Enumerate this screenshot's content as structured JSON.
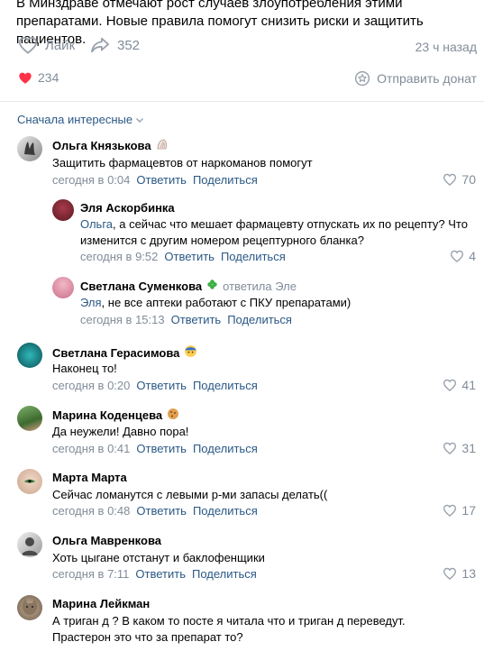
{
  "post": {
    "text": "В Минздраве отмечают рост случаев злоупотребления этими препаратами. Новые правила помогут снизить риски и защитить пациентов.",
    "like_label": "Лайк",
    "share_count": "352",
    "time": "23 ч назад",
    "reactions_count": "234",
    "donate_label": "Отправить донат"
  },
  "sort": {
    "label": "Сначала интересные"
  },
  "labels": {
    "reply": "Ответить",
    "share": "Поделиться"
  },
  "comments": [
    {
      "author": "Ольга Князькова",
      "text": "Защитить фармацевтов от наркоманов помогут",
      "time": "сегодня в 0:04",
      "likes": "70"
    },
    {
      "author": "Эля Аскорбинка",
      "mention": "Ольга",
      "text": ", а сейчас что мешает фармацевту отпускать их по рецепту? Что изменится с другим номером рецептурного бланка?",
      "time": "сегодня в 9:52",
      "likes": "4"
    },
    {
      "author": "Светлана Суменкова",
      "replied_to": "ответила Эле",
      "mention": "Эля",
      "text": ", не все аптеки работают с ПКУ препаратами)",
      "time": "сегодня в 15:13"
    },
    {
      "author": "Светлана Герасимова",
      "text": "Наконец то!",
      "time": "сегодня в 0:20",
      "likes": "41"
    },
    {
      "author": "Марина Коденцева",
      "text": "Да неужели! Давно пора!",
      "time": "сегодня в 0:41",
      "likes": "31"
    },
    {
      "author": "Марта Марта",
      "text": "Сейчас ломанутся с левыми р-ми запасы делать((",
      "time": "сегодня в 0:48",
      "likes": "17"
    },
    {
      "author": "Ольга Мавренкова",
      "text": "Хоть цыгане отстанут и баклофенщики",
      "time": "сегодня в 7:11",
      "likes": "13"
    },
    {
      "author": "Марина Лейкман",
      "text": "А триган д ? В каком то посте я читала что и триган д переведут. Прастерон это что за препарат то?"
    }
  ]
}
